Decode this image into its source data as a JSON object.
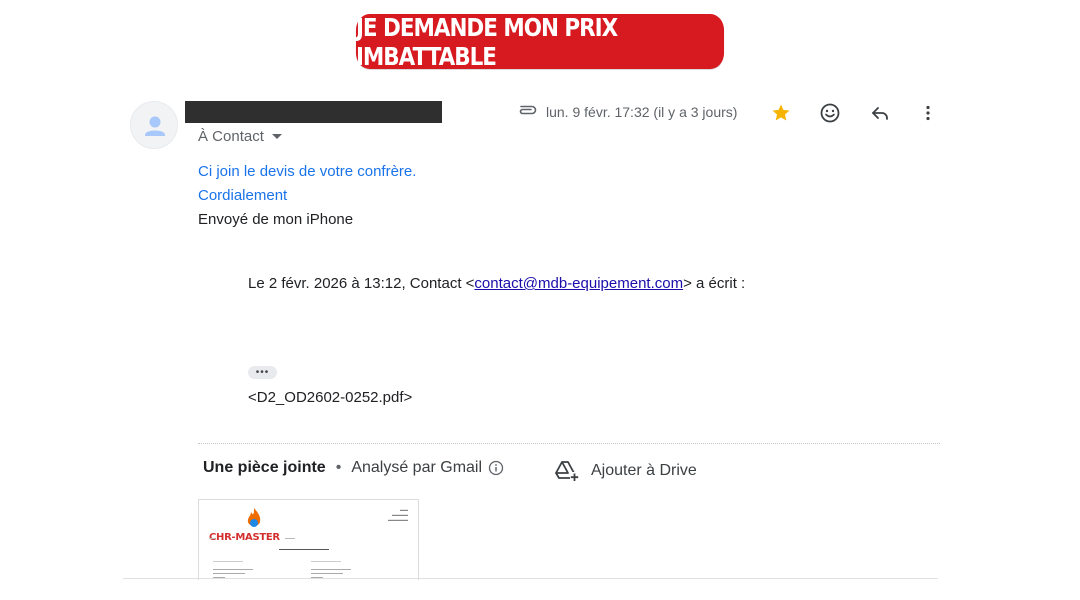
{
  "banner": {
    "label": "JE DEMANDE MON PRIX IMBATTABLE"
  },
  "header": {
    "recipient": "À Contact",
    "date": "lun. 9 févr. 17:32 (il y a 3 jours)"
  },
  "icons": {
    "attachment": "paperclip-icon",
    "star": "star-icon",
    "emoji": "emoji-icon",
    "reply": "reply-icon",
    "more": "more-vert-icon",
    "avatar": "person-icon",
    "info": "info-icon",
    "drive": "add-to-drive-icon"
  },
  "colors": {
    "banner": "#d71920",
    "star": "#f6b400",
    "link": "#1a73e8"
  },
  "message": {
    "line1": "Ci join le devis de votre confrère.",
    "line2": "Cordialement",
    "line3": "Envoyé de mon iPhone"
  },
  "quote": {
    "prefix": "Le 2 févr. 2026 à 13:12, Contact <",
    "email": "contact@mdb-equipement.com",
    "suffix": "> a écrit :",
    "ellipsis": "•••",
    "attachment": "<D2_OD2602-0252.pdf>"
  },
  "attachments": {
    "title": "Une pièce jointe",
    "separator": "•",
    "scanned": "Analysé par Gmail",
    "drive_label": "Ajouter à Drive",
    "thumbnail_logo": "CHR-MASTER"
  }
}
